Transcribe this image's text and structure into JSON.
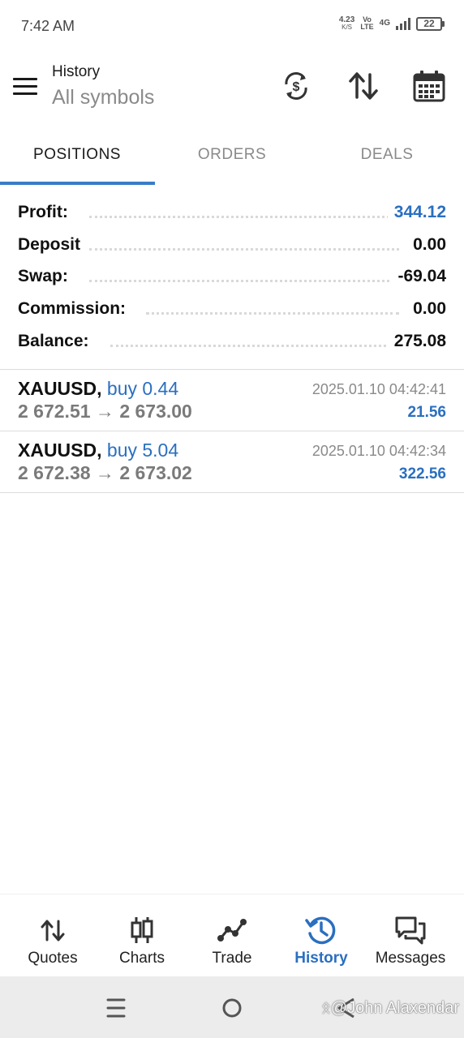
{
  "status_bar": {
    "time": "7:42 AM",
    "net_speed_value": "4.23",
    "net_speed_unit": "K/S",
    "volte_top": "Vo",
    "volte_bottom": "LTE",
    "network": "4G",
    "battery": "22"
  },
  "toolbar": {
    "title": "History",
    "subtitle": "All symbols",
    "icons": [
      "sync-currency-icon",
      "sort-icon",
      "calendar-icon"
    ]
  },
  "tabs": [
    {
      "label": "POSITIONS",
      "active": true
    },
    {
      "label": "ORDERS",
      "active": false
    },
    {
      "label": "DEALS",
      "active": false
    }
  ],
  "summary": [
    {
      "label": "Profit:",
      "value": "344.12",
      "highlight": true
    },
    {
      "label": "Deposit",
      "value": "0.00",
      "highlight": false
    },
    {
      "label": "Swap:",
      "value": "-69.04",
      "highlight": false
    },
    {
      "label": "Commission:",
      "value": "0.00",
      "highlight": false
    },
    {
      "label": "Balance:",
      "value": "275.08",
      "highlight": false
    }
  ],
  "positions": [
    {
      "symbol": "XAUUSD,",
      "type": "buy 0.44",
      "time": "2025.01.10 04:42:41",
      "open_price": "2 672.51",
      "arrow": "→",
      "close_price": "2 673.00",
      "profit": "21.56"
    },
    {
      "symbol": "XAUUSD,",
      "type": "buy 5.04",
      "time": "2025.01.10 04:42:34",
      "open_price": "2 672.38",
      "arrow": "→",
      "close_price": "2 673.02",
      "profit": "322.56"
    }
  ],
  "bottom_nav": [
    {
      "label": "Quotes",
      "icon": "quotes-arrows-icon",
      "active": false
    },
    {
      "label": "Charts",
      "icon": "candlestick-icon",
      "active": false
    },
    {
      "label": "Trade",
      "icon": "trade-line-icon",
      "active": false
    },
    {
      "label": "History",
      "icon": "history-clock-icon",
      "active": true
    },
    {
      "label": "Messages",
      "icon": "chat-bubbles-icon",
      "active": false
    }
  ],
  "watermark": "ᛟ@John Alaxendar",
  "colors": {
    "accent": "#2a6fc0",
    "tab_indicator": "#3a7cc9",
    "muted_text": "#8a8a8a",
    "system_nav_bg": "#ececec"
  }
}
